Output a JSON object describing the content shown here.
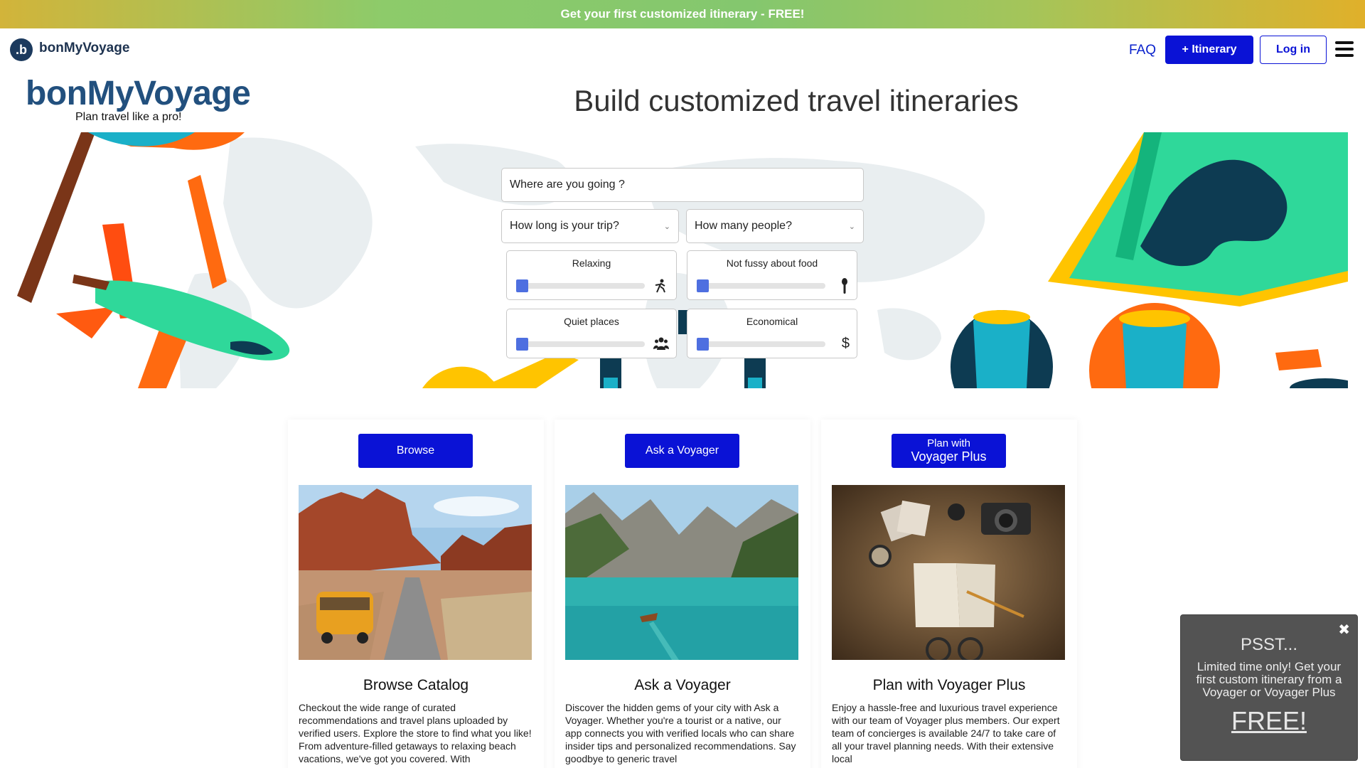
{
  "promo": {
    "text": "Get your first customized itinerary - FREE!"
  },
  "nav": {
    "brand_mark": ".b",
    "brand_name": "bonMyVoyage",
    "faq": "FAQ",
    "itinerary_button": "+ Itinerary",
    "login_button": "Log in",
    "menu_icon": "hamburger-icon"
  },
  "hero": {
    "logo_title": "bonMyVoyage",
    "logo_tagline": "Plan travel like a pro!",
    "title": "Build customized travel itineraries"
  },
  "search": {
    "destination_placeholder": "Where are you going ?",
    "duration_select": "How long is your trip?",
    "people_select": "How many people?",
    "sliders": [
      {
        "label": "Relaxing",
        "icon": "hiker-icon",
        "value": 0
      },
      {
        "label": "Not fussy about food",
        "icon": "fork-icon",
        "value": 0
      },
      {
        "label": "Quiet places",
        "icon": "group-icon",
        "value": 0
      },
      {
        "label": "Economical",
        "icon": "dollar-icon",
        "value": 0
      }
    ]
  },
  "cards": [
    {
      "button": "Browse",
      "title": "Browse Catalog",
      "image": "desert-road-van",
      "desc": "Checkout the wide range of curated recommendations and travel plans uploaded by verified users. Explore the store to find what you like! From adventure-filled getaways to relaxing beach vacations, we've got you covered. With"
    },
    {
      "button": "Ask a Voyager",
      "title": "Ask a Voyager",
      "image": "mountain-lake-boat",
      "desc": "Discover the hidden gems of your city with Ask a Voyager. Whether you're a tourist or a native, our app connects you with verified locals who can share insider tips and personalized recommendations. Say goodbye to generic travel"
    },
    {
      "button_line1": "Plan with",
      "button_line2": "Voyager Plus",
      "title": "Plan with Voyager Plus",
      "image": "map-camera-notebook",
      "desc": "Enjoy a hassle-free and luxurious travel experience with our team of Voyager plus members. Our expert team of concierges is available 24/7 to take care of all your travel planning needs. With their extensive local"
    }
  ],
  "popup": {
    "title": "PSST...",
    "body": "Limited time only! Get your first custom itinerary from a Voyager or Voyager Plus",
    "cta": "FREE!",
    "close": "✖"
  },
  "colors": {
    "primary": "#0a12d6",
    "brand_blue": "#22507e",
    "accent_green": "#2fd89a",
    "accent_orange": "#ff6a10"
  }
}
